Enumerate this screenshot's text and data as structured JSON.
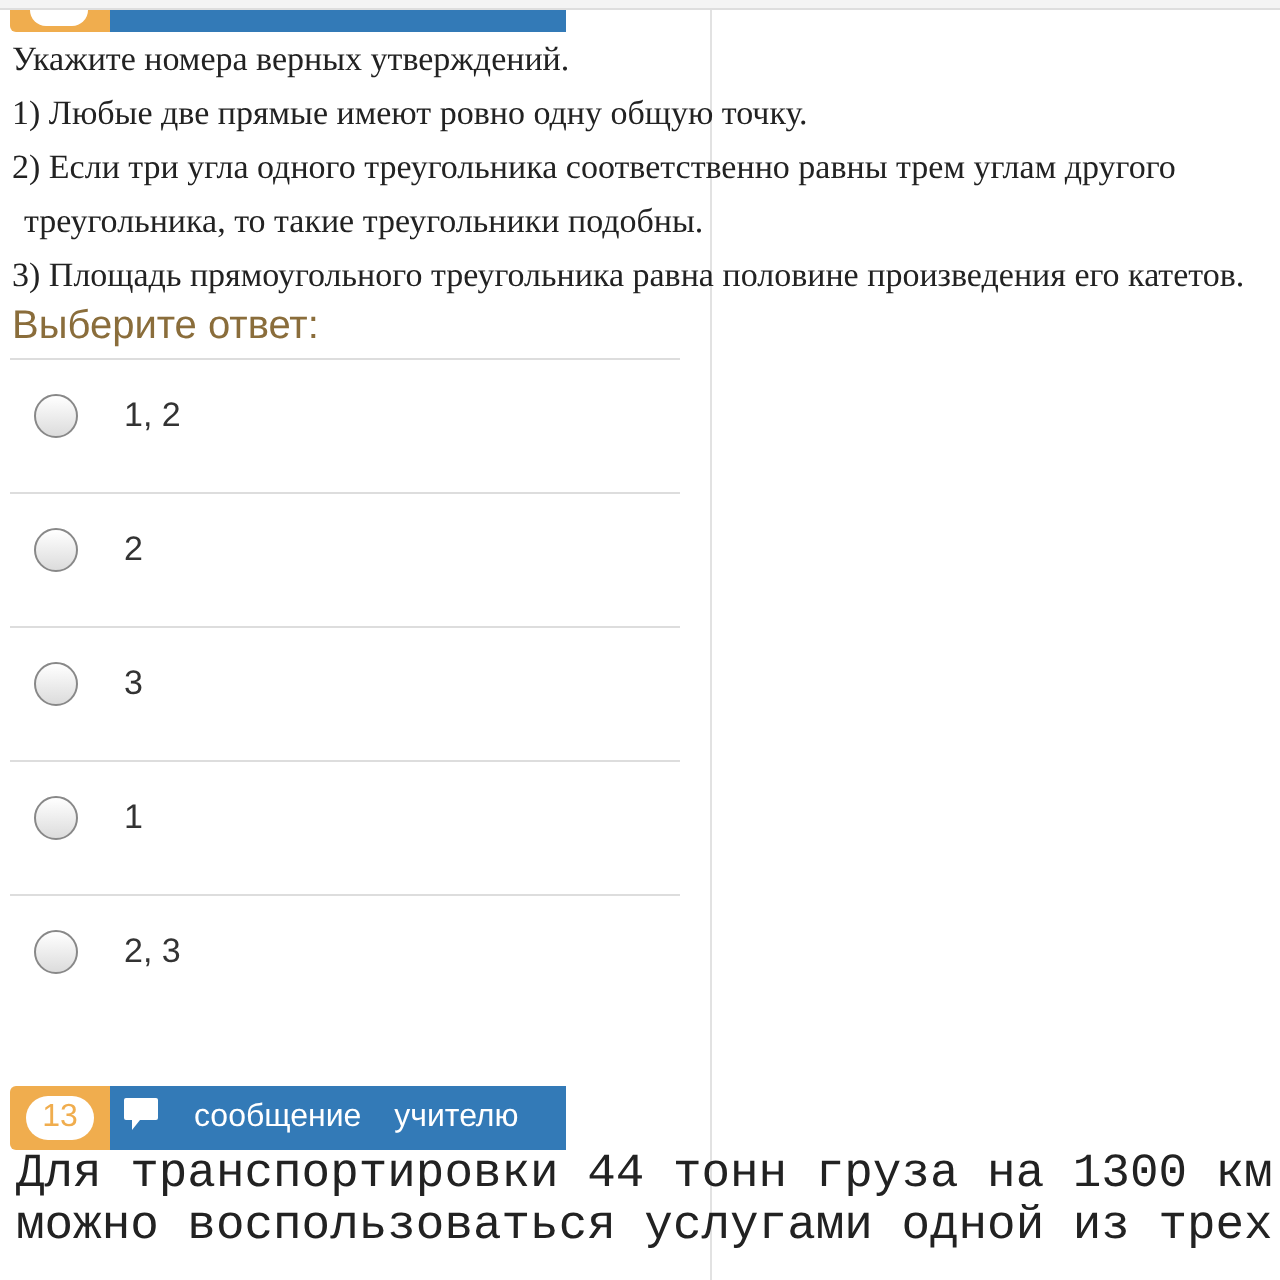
{
  "question": {
    "prompt": "Укажите номера верных утверждений.",
    "statements": [
      "1) Любые две прямые имеют ровно одну общую точку.",
      "2) Если три угла одного треугольника соответственно равны трем углам другого треугольника, то такие треугольники подобны.",
      "3) Площадь прямоугольного треугольника равна половине произведения его катетов."
    ]
  },
  "answer_prompt": "Выберите ответ:",
  "options": [
    {
      "label": "1, 2",
      "selected": false
    },
    {
      "label": "2",
      "selected": false
    },
    {
      "label": "3",
      "selected": false
    },
    {
      "label": "1",
      "selected": false
    },
    {
      "label": "2, 3",
      "selected": false
    }
  ],
  "next_question": {
    "number": "13",
    "message_button": "сообщение учителю",
    "text": "Для транспортировки 44 тонн груза на 1300 км можно воспользоваться услугами одной из трех"
  }
}
